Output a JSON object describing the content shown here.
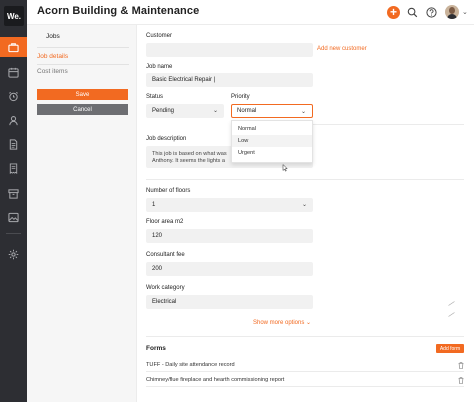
{
  "app": {
    "logo_text": "We.",
    "title": "Acorn Building & Maintenance",
    "accent_color": "#f26a21",
    "rail_color": "#2d2e33"
  },
  "rail": {
    "items": [
      {
        "icon": "briefcase-icon",
        "active": true
      },
      {
        "icon": "calendar-icon"
      },
      {
        "icon": "alarm-clock-icon"
      },
      {
        "icon": "user-icon"
      },
      {
        "icon": "document-icon"
      },
      {
        "icon": "receipt-icon"
      },
      {
        "icon": "archive-box-icon"
      },
      {
        "icon": "image-icon"
      },
      {
        "icon": "settings-gear-icon"
      }
    ]
  },
  "header_icons": [
    "plus-icon",
    "search-icon",
    "help-icon",
    "avatar",
    "chevron-down-icon"
  ],
  "subnav": {
    "heading": "Jobs",
    "items": [
      {
        "label": "Job details",
        "active": true
      },
      {
        "label": "Cost items",
        "active": false
      }
    ],
    "save_label": "Save",
    "cancel_label": "Cancel"
  },
  "form": {
    "customer": {
      "label": "Customer",
      "value": "",
      "add_link": "Add new customer"
    },
    "job_name": {
      "label": "Job name",
      "value": "Basic Electrical Repair |"
    },
    "status": {
      "label": "Status",
      "value": "Pending"
    },
    "priority": {
      "label": "Priority",
      "value": "Normal",
      "options": [
        "Normal",
        "Low",
        "Urgent"
      ],
      "hovered_option": "Low"
    },
    "job_description": {
      "label": "Job description",
      "line1": "This job is based on what was",
      "line2": "Anthony. It seems the lights a"
    },
    "floors": {
      "label": "Number of floors",
      "value": "1"
    },
    "floor_area": {
      "label": "Floor area m2",
      "value": "120"
    },
    "consultant_fee": {
      "label": "Consultant fee",
      "value": "200"
    },
    "work_category": {
      "label": "Work category",
      "value": "Electrical"
    },
    "show_more": "Show more options ⌄"
  },
  "forms": {
    "title": "Forms",
    "add_label": "Add form",
    "items": [
      "TUFF - Daily site attendance record",
      "Chimney/flue fireplace and hearth commissioning report"
    ]
  }
}
